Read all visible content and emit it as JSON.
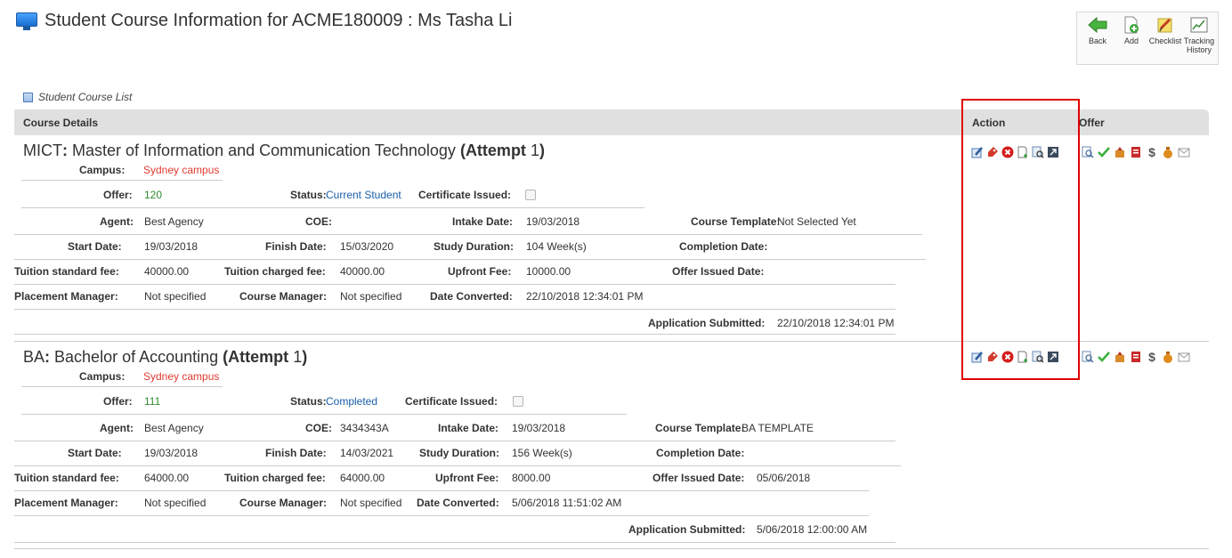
{
  "page": {
    "title": "Student Course Information for ACME180009 : Ms Tasha Li"
  },
  "toolbar": {
    "items": [
      {
        "label": "Back",
        "icon": "back-arrow-icon"
      },
      {
        "label": "Add",
        "icon": "add-document-icon"
      },
      {
        "label": "Checklist",
        "icon": "checklist-icon"
      },
      {
        "label": "Tracking History",
        "icon": "tracking-chart-icon"
      }
    ]
  },
  "list": {
    "caption": "Student Course List",
    "columns": {
      "course_details": "Course Details",
      "action": "Action",
      "offer": "Offer"
    }
  },
  "labels": {
    "campus": "Campus:",
    "offer": "Offer:",
    "status": "Status:",
    "certificate_issued": "Certificate Issued:",
    "agent": "Agent:",
    "coe": "COE:",
    "intake_date": "Intake Date:",
    "course_template": "Course Template:",
    "start_date": "Start Date:",
    "finish_date": "Finish Date:",
    "study_duration": "Study Duration:",
    "completion_date": "Completion Date:",
    "tuition_standard_fee": "Tuition standard fee:",
    "tuition_charged_fee": "Tuition charged fee:",
    "upfront_fee": "Upfront Fee:",
    "offer_issued_date": "Offer Issued Date:",
    "placement_manager": "Placement Manager:",
    "course_manager": "Course Manager:",
    "date_converted": "Date Converted:",
    "application_submitted": "Application Submitted:"
  },
  "courses": [
    {
      "code": "MICT",
      "name": "Master of Information and Communication Technology",
      "attempt_word": "Attempt",
      "attempt_num": "1",
      "campus": "Sydney campus",
      "offer": "120",
      "status": "Current Student",
      "certificate_issued": false,
      "agent": "Best Agency",
      "coe": "",
      "intake_date": "19/03/2018",
      "course_template": "Not Selected Yet",
      "start_date": "19/03/2018",
      "finish_date": "15/03/2020",
      "study_duration": "104 Week(s)",
      "completion_date": "",
      "tuition_standard_fee": "40000.00",
      "tuition_charged_fee": "40000.00",
      "upfront_fee": "10000.00",
      "offer_issued_date": "",
      "placement_manager": "Not specified",
      "course_manager": "Not specified",
      "date_converted": "22/10/2018 12:34:01 PM",
      "application_submitted": "22/10/2018 12:34:01 PM"
    },
    {
      "code": "BA",
      "name": "Bachelor of Accounting",
      "attempt_word": "Attempt",
      "attempt_num": "1",
      "campus": "Sydney campus",
      "offer": "111",
      "status": "Completed",
      "certificate_issued": false,
      "agent": "Best Agency",
      "coe": "3434343A",
      "intake_date": "19/03/2018",
      "course_template": "BA TEMPLATE",
      "start_date": "19/03/2018",
      "finish_date": "14/03/2021",
      "study_duration": "156 Week(s)",
      "completion_date": "",
      "tuition_standard_fee": "64000.00",
      "tuition_charged_fee": "64000.00",
      "upfront_fee": "8000.00",
      "offer_issued_date": "05/06/2018",
      "placement_manager": "Not specified",
      "course_manager": "Not specified",
      "date_converted": "5/06/2018 11:51:02 AM",
      "application_submitted": "5/06/2018 12:00:00 AM"
    }
  ],
  "action_icons": [
    "edit-icon",
    "tag-icon",
    "delete-icon",
    "add-page-icon",
    "database-search-icon",
    "export-icon"
  ],
  "offer_icons": [
    "preview-icon",
    "approve-check-icon",
    "package-icon",
    "pdf-icon",
    "dollar-icon",
    "money-bag-icon",
    "email-icon"
  ],
  "offer_dollar_glyph": "$",
  "colors": {
    "campus_text": "#e03a2f",
    "offer_text": "#2e8b2e",
    "status_text": "#1a5ea8",
    "highlight": "#e00000"
  }
}
